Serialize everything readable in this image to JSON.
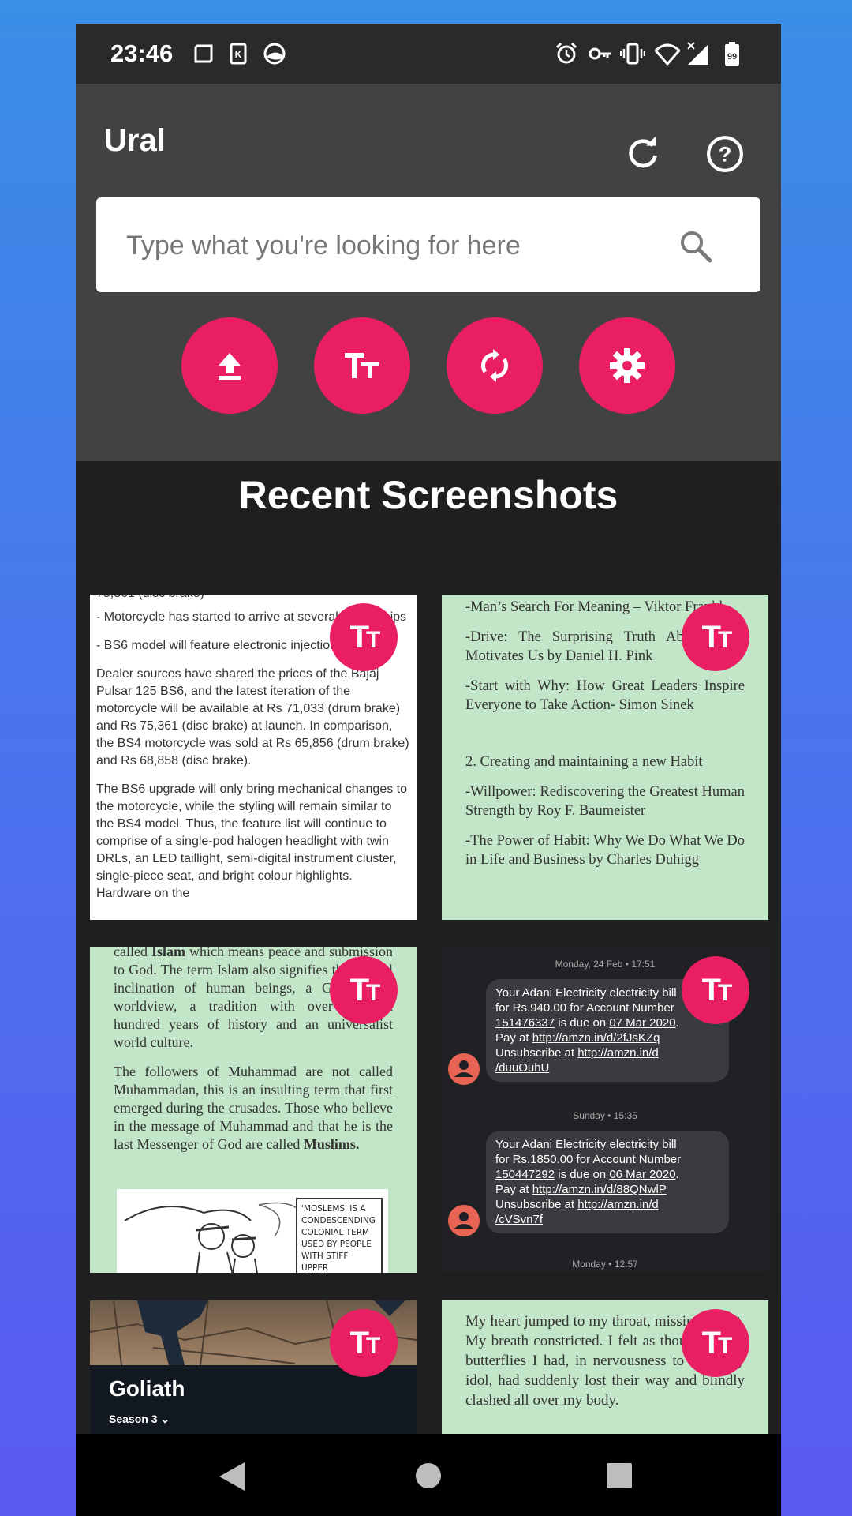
{
  "status_bar": {
    "time": "23:46",
    "battery": "99",
    "icons": [
      "screenshot-icon",
      "k-app-icon",
      "vpn-icon",
      "alarm-icon",
      "key-icon",
      "vibrate-icon",
      "wifi-icon",
      "signal-icon",
      "battery-icon"
    ]
  },
  "app_bar": {
    "title": "Ural",
    "refresh_icon": "refresh-icon",
    "help_icon": "help-icon"
  },
  "search": {
    "placeholder": "Type what you're looking for here",
    "value": ""
  },
  "actions": [
    {
      "name": "upload",
      "icon": "upload-icon"
    },
    {
      "name": "text",
      "icon": "text-size-icon"
    },
    {
      "name": "sync",
      "icon": "sync-icon"
    },
    {
      "name": "settings",
      "icon": "gear-icon"
    }
  ],
  "section_title": "Recent Screenshots",
  "accent_color": "#e91e63",
  "cards": {
    "card1": {
      "cut_top": "75,361 (disc brake)",
      "p1": "- Motorcycle has started to arrive at several dealerships",
      "p2": "- BS6 model will feature electronic injection system",
      "p3": "Dealer sources have shared the prices of the Bajaj Pulsar 125  BS6, and the latest iteration of the motorcycle will be available at Rs 71,033 (drum brake) and Rs 75,361 (disc brake) at launch. In comparison, the BS4 motorcycle was sold at Rs 65,856 (drum brake) and Rs 68,858 (disc brake).",
      "p4": "The BS6 upgrade will only bring mechanical changes to the motorcycle, while the styling will remain similar to the BS4 model. Thus, the feature list will continue to comprise of a single-pod halogen headlight with twin DRLs, an LED taillight, semi-digital instrument cluster, single-piece seat, and bright colour highlights. Hardware on the"
    },
    "card2": {
      "p1": "-Man’s Search For Meaning – Viktor Frankl",
      "p2": "-Drive: The Surprising Truth About What Motivates Us by Daniel H. Pink",
      "p3": "-Start with Why: How Great Leaders Inspire Everyone to Take Action- Simon Sinek",
      "p4": "2. Creating and maintaining a new Habit",
      "p5": "-Willpower: Rediscovering the Greatest Human Strength by Roy F. Baumeister",
      "p6": "-The Power of Habit: Why We Do What We Do in Life and Business by Charles Duhigg"
    },
    "card3": {
      "p1_a": "called ",
      "p1_bold": "Islam",
      "p1_b": " which means peace and submission to God. The term Islam also signifies the natural inclination of human beings, a God-centred worldview, a tradition with over fourteen hundred years of history and an universalist world culture.",
      "p2_a": "The followers of Muhammad are not called Muhammadan, this is an insulting term that first emerged during the crusades. Those who believe in the message of Muhammad and that he is the last Messenger of God are called ",
      "p2_bold": "Muslims.",
      "cartoon_caption": "'MOSLEMS' IS A CONDESCENDING COLONIAL TERM USED BY PEOPLE WITH STIFF UPPER"
    },
    "card4": {
      "date1": "Monday, 24 Feb • 17:51",
      "msg1_l1": "Your Adani Electricity electricity bill",
      "msg1_l2": "for Rs.940.00 for Account Number",
      "msg1_acct": "151476337",
      "msg1_due": " is due on ",
      "msg1_date": "07 Mar 2020",
      "msg1_pay": "Pay at ",
      "msg1_link1": "http://amzn.in/d/2fJsKZq",
      "msg1_unsub": "Unsubscribe at ",
      "msg1_link2a": "http://amzn.in/d",
      "msg1_link2b": "/duuOuhU",
      "date2": "Sunday • 15:35",
      "msg2_l1": "Your Adani Electricity electricity bill",
      "msg2_l2": "for Rs.1850.00 for Account Number",
      "msg2_acct": "150447292",
      "msg2_due": " is due on ",
      "msg2_date": "06 Mar 2020",
      "msg2_pay": "Pay at ",
      "msg2_link1": "http://amzn.in/d/88QNwlP",
      "msg2_unsub": "Unsubscribe at ",
      "msg2_link2a": "http://amzn.in/d",
      "msg2_link2b": "/cVSvn7f",
      "date3": "Monday • 12:57"
    },
    "card5": {
      "title": "Goliath",
      "season": "Season 3"
    },
    "card6": {
      "text": "My heart jumped to my throat, missing a beat. My breath constricted. I felt as though all the butterflies I had, in nervousness to meet my idol, had suddenly lost their way and blindly clashed all over my body."
    }
  },
  "nav": {
    "back": "back-icon",
    "home": "home-icon",
    "recents": "recents-icon"
  }
}
